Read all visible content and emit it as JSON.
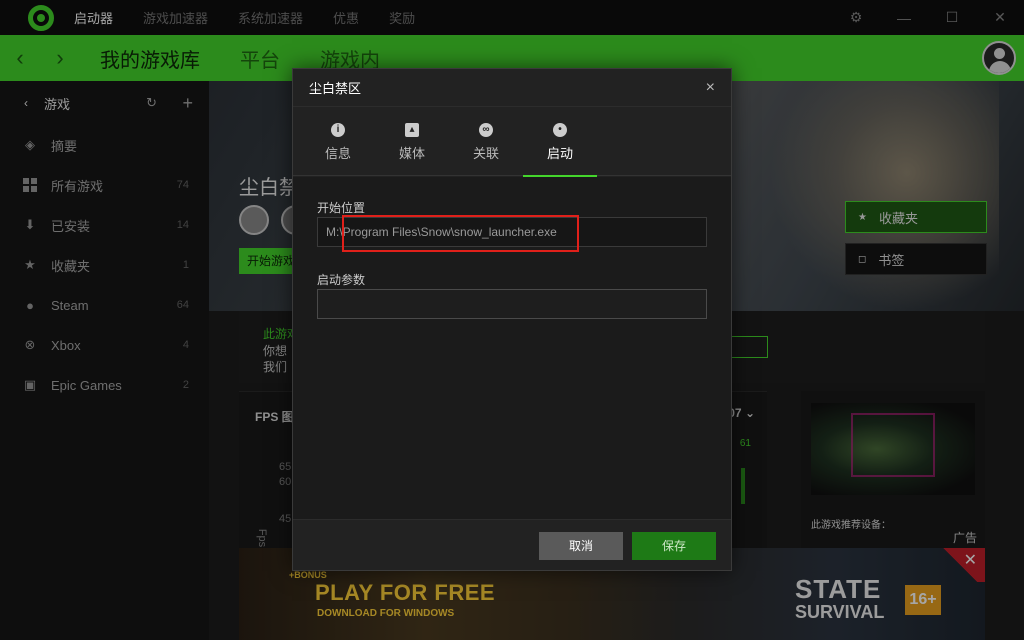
{
  "topbar": {
    "nav": [
      "启动器",
      "游戏加速器",
      "系统加速器",
      "优惠",
      "奖励"
    ],
    "active_index": 0,
    "controls": [
      "gear-icon",
      "minimize-icon",
      "maximize-icon",
      "close-icon"
    ]
  },
  "greenbar": {
    "back": "‹",
    "forward": "›",
    "tabs": [
      "我的游戏库",
      "平台",
      "游戏内"
    ]
  },
  "sidebar": {
    "header": "游戏",
    "items": [
      {
        "label": "摘要",
        "count": "",
        "icon": "layers-icon"
      },
      {
        "label": "所有游戏",
        "count": "74",
        "icon": "grid-icon"
      },
      {
        "label": "已安装",
        "count": "14",
        "icon": "download-icon"
      },
      {
        "label": "收藏夹",
        "count": "1",
        "icon": "star-icon"
      },
      {
        "label": "Steam",
        "count": "64",
        "icon": "steam-icon"
      },
      {
        "label": "Xbox",
        "count": "4",
        "icon": "xbox-icon"
      },
      {
        "label": "Epic Games",
        "count": "2",
        "icon": "epic-icon"
      }
    ]
  },
  "main": {
    "game_title_partial": "尘白禁",
    "start_partial": "开始游戏",
    "fav_label": "收藏夹",
    "bookmark_label": "书签",
    "panel_line1": "此游戏",
    "panel_line2": "你想",
    "panel_line3": "我们",
    "fps_title": "FPS 图",
    "fps_time": ":07",
    "fps_y": [
      "65",
      "60",
      "45"
    ],
    "fps_axis": "Fps",
    "fps_green": "61",
    "ad_recommend": "此游戏推荐设备：",
    "ad_tag": "广告",
    "banner": {
      "bonus": "+BONUS",
      "play": "PLAY FOR FREE",
      "download": "DOWNLOAD FOR WINDOWS",
      "state": "STATE",
      "of": "OF",
      "survival": "SURVIVAL",
      "age": "16+"
    }
  },
  "modal": {
    "title": "尘白禁区",
    "close": "×",
    "tabs": [
      {
        "label": "信息",
        "icon": "info-icon"
      },
      {
        "label": "媒体",
        "icon": "image-icon"
      },
      {
        "label": "关联",
        "icon": "link-icon"
      },
      {
        "label": "启动",
        "icon": "location-icon"
      }
    ],
    "active_tab": 3,
    "start_location_label": "开始位置",
    "start_location_value": "M:\\Program Files\\Snow\\snow_launcher.exe",
    "launch_params_label": "启动参数",
    "launch_params_value": "",
    "cancel": "取消",
    "save": "保存"
  },
  "colors": {
    "accent": "#44d62c",
    "highlight_box": "#e0201a"
  }
}
